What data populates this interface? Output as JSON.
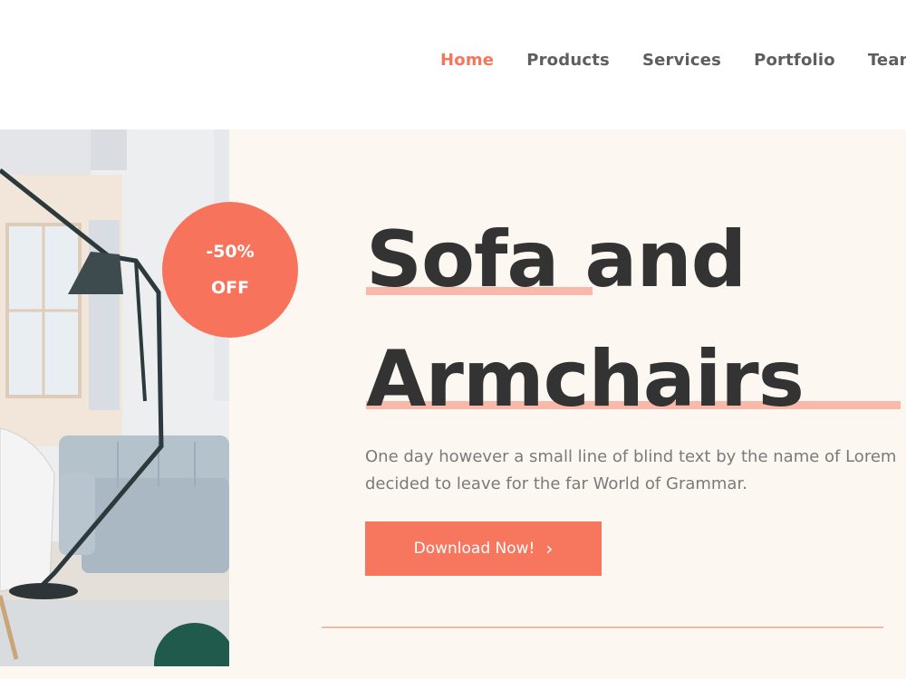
{
  "nav": {
    "items": [
      {
        "label": "Home",
        "active": true
      },
      {
        "label": "Products",
        "active": false
      },
      {
        "label": "Services",
        "active": false
      },
      {
        "label": "Portfolio",
        "active": false
      },
      {
        "label": "Team",
        "active": false
      }
    ]
  },
  "hero": {
    "badge": {
      "line1": "-50%",
      "line2": "OFF"
    },
    "title": {
      "line1": "Sofa and",
      "line2": "Armchairs"
    },
    "description": {
      "line1": "One day however a small line of blind text by the name of Lorem",
      "line2": "decided to leave for the far World of Grammar."
    },
    "cta": {
      "label": "Download Now!",
      "icon": "chevron-right-icon"
    }
  },
  "colors": {
    "accent": "#f7735c",
    "heading": "#333333",
    "text": "#7a7a7a",
    "hero_bg": "#fdf7f2",
    "underline": "#f8b9ab"
  }
}
